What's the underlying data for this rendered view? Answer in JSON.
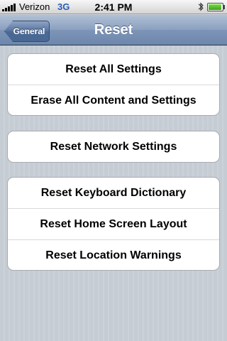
{
  "status_bar": {
    "carrier": "Verizon",
    "network": "3G",
    "time": "2:41 PM",
    "icons": [
      "signal-icon",
      "bluetooth-icon",
      "battery-icon"
    ]
  },
  "nav": {
    "back_label": "General",
    "title": "Reset"
  },
  "groups": [
    {
      "items": [
        {
          "label": "Reset All Settings"
        },
        {
          "label": "Erase All Content and Settings"
        }
      ]
    },
    {
      "items": [
        {
          "label": "Reset Network Settings"
        }
      ]
    },
    {
      "items": [
        {
          "label": "Reset Keyboard Dictionary"
        },
        {
          "label": "Reset Home Screen Layout"
        },
        {
          "label": "Reset Location Warnings"
        }
      ]
    }
  ],
  "colors": {
    "background": "#c5ccd4",
    "nav_bar": "#7c94b7",
    "network_indicator": "#2b5cb3",
    "cell_background": "#ffffff"
  }
}
